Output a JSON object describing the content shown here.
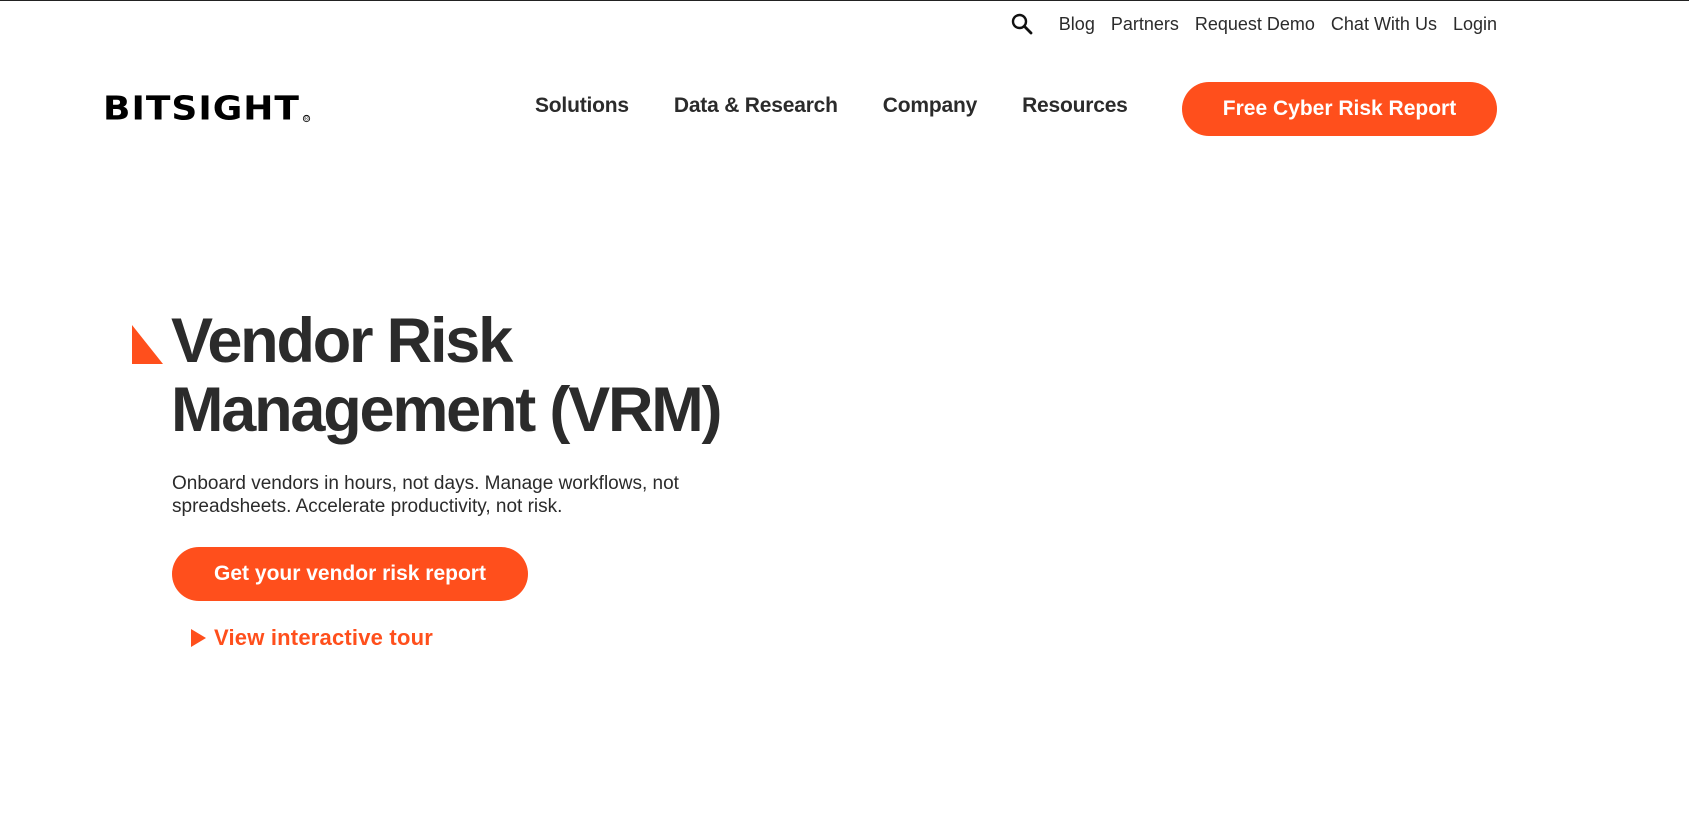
{
  "colors": {
    "accent": "#ff4f1c",
    "text": "#2b2b2b",
    "background": "#ffffff"
  },
  "utility_nav": {
    "search_icon": "search-icon",
    "links": [
      "Blog",
      "Partners",
      "Request Demo",
      "Chat With Us",
      "Login"
    ]
  },
  "header": {
    "logo_text": "BITSIGHT",
    "logo_mark": "®",
    "nav": [
      "Solutions",
      "Data & Research",
      "Company",
      "Resources"
    ],
    "cta_label": "Free Cyber Risk Report"
  },
  "hero": {
    "title_line1": "Vendor Risk",
    "title_line2": "Management (VRM)",
    "subtitle": "Onboard vendors in hours, not days. Manage workflows, not spreadsheets. Accelerate productivity, not risk.",
    "cta_label": "Get your vendor risk report",
    "tour_label": "View interactive tour",
    "tour_icon": "play-icon"
  }
}
